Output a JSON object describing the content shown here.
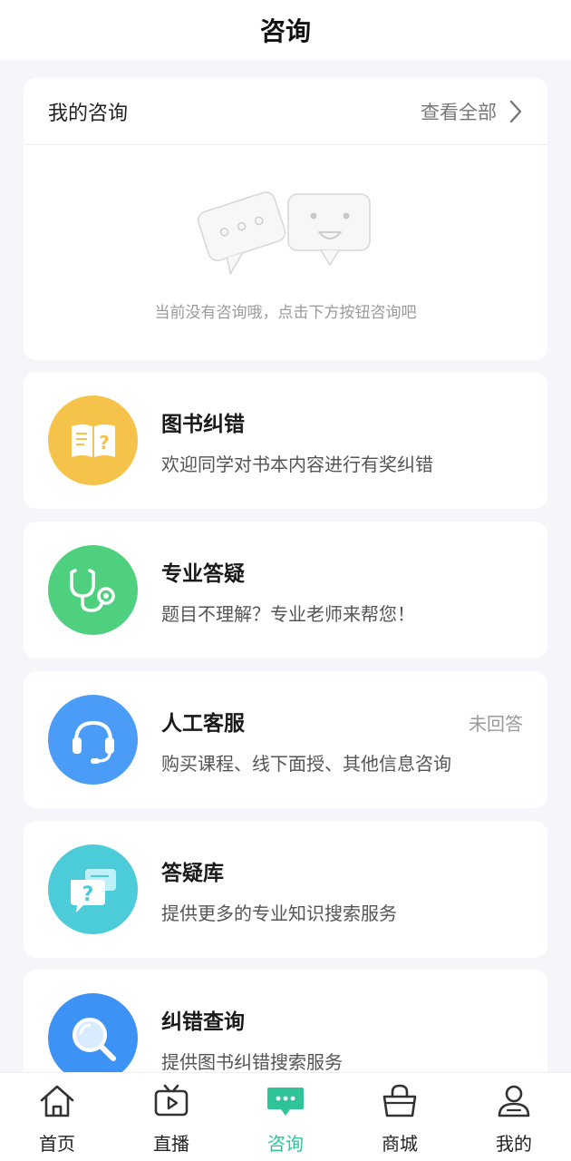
{
  "header": {
    "title": "咨询"
  },
  "my_consult": {
    "label": "我的咨询",
    "view_all": "查看全部",
    "empty_text": "当前没有咨询哦，点击下方按钮咨询吧"
  },
  "services": [
    {
      "title": "图书纠错",
      "desc": "欢迎同学对书本内容进行有奖纠错",
      "icon": "book-question-icon",
      "color": "#f5c34a"
    },
    {
      "title": "专业答疑",
      "desc": "题目不理解？专业老师来帮您！",
      "icon": "stethoscope-icon",
      "color": "#4fd07e"
    },
    {
      "title": "人工客服",
      "desc": "购买课程、线下面授、其他信息咨询",
      "status": "未回答",
      "icon": "headset-icon",
      "color": "#4a9cf7"
    },
    {
      "title": "答疑库",
      "desc": "提供更多的专业知识搜索服务",
      "icon": "chat-question-icon",
      "color": "#4ccbd9"
    },
    {
      "title": "纠错查询",
      "desc": "提供图书纠错搜索服务",
      "icon": "magnifier-icon",
      "color": "#3d93f5"
    }
  ],
  "tabbar": {
    "active_color": "#2fc39a",
    "items": [
      {
        "label": "首页",
        "icon": "home-icon"
      },
      {
        "label": "直播",
        "icon": "tv-play-icon"
      },
      {
        "label": "咨询",
        "icon": "chat-bubble-icon",
        "active": true
      },
      {
        "label": "商城",
        "icon": "shopping-basket-icon"
      },
      {
        "label": "我的",
        "icon": "user-icon"
      }
    ]
  }
}
